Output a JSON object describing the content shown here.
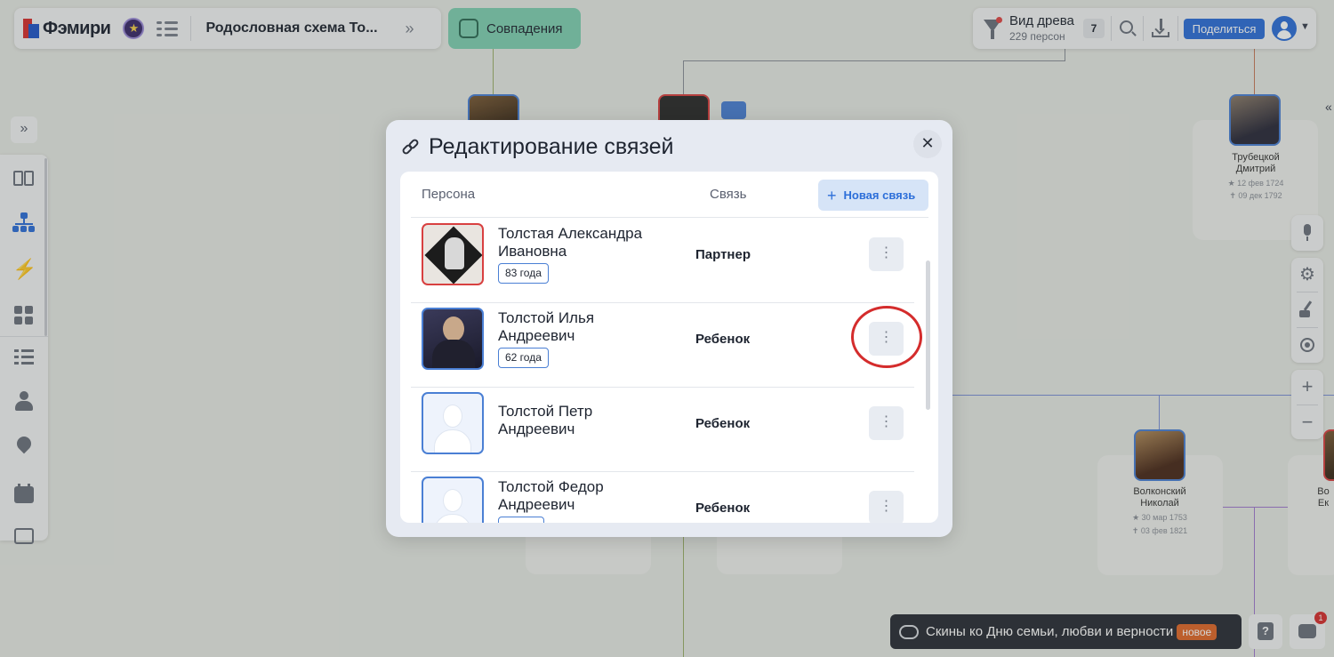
{
  "header": {
    "logo_text": "Фэмири",
    "tree_title": "Родословная схема То...",
    "matches_label": "Совпадения",
    "view_title": "Вид древа",
    "person_count": "229 персон",
    "filter_count": "7",
    "share_label": "Поделиться"
  },
  "background_cards": [
    {
      "name_line1": "Трубецкой",
      "name_line2": "Дмитрий",
      "birth": "12 фев 1724",
      "death": "09 дек 1792"
    },
    {
      "name_line1": "Волконский",
      "name_line2": "Николай",
      "birth": "30 мар 1753",
      "death": "03 фев 1821"
    },
    {
      "name_line1": "Во",
      "name_line2": "Ек"
    }
  ],
  "modal": {
    "title": "Редактирование связей",
    "col_person": "Персона",
    "col_relation": "Связь",
    "new_link_label": "Новая связь",
    "rows": [
      {
        "name": "Толстая Александра Ивановна",
        "age": "83 года",
        "relation": "Партнер"
      },
      {
        "name": "Толстой Илья Андреевич",
        "age": "62 года",
        "relation": "Ребенок"
      },
      {
        "name": "Толстой Петр Андреевич",
        "age": "",
        "relation": "Ребенок"
      },
      {
        "name": "Толстой Федор Андреевич",
        "age": "",
        "relation": "Ребенок"
      }
    ]
  },
  "promo": {
    "text": "Скины ко Дню семьи, любви и верности",
    "badge": "новое"
  },
  "chat_unread": "1",
  "colors": {
    "accent_blue": "#2d6fd9",
    "match_green": "#7fd0b3",
    "highlight_red": "#d42c2c"
  }
}
